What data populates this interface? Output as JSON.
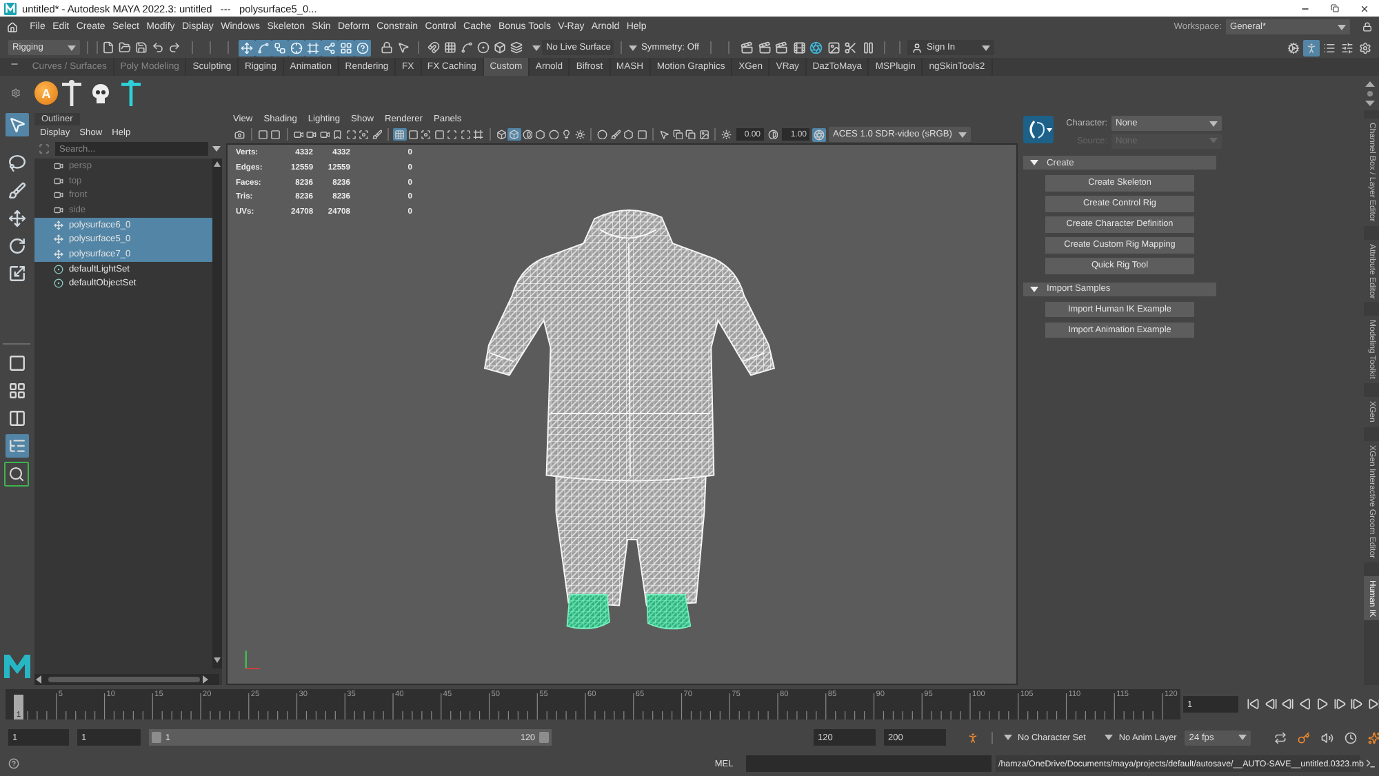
{
  "window": {
    "title": "untitled* - Autodesk MAYA 2022.3: untitled   ---   polysurface5_0..."
  },
  "menu_bar": {
    "items": [
      "File",
      "Edit",
      "Create",
      "Select",
      "Modify",
      "Display",
      "Windows",
      "Skeleton",
      "Skin",
      "Deform",
      "Constrain",
      "Control",
      "Cache",
      "Bonus Tools",
      "V-Ray",
      "Arnold",
      "Help"
    ],
    "workspace_label": "Workspace:",
    "workspace": "General*"
  },
  "status_line": {
    "menu_set": "Rigging",
    "selection_masks": [
      {
        "on": true
      },
      {
        "on": true
      },
      {
        "on": true
      },
      {
        "on": true
      },
      {
        "on": true
      },
      {
        "on": true
      },
      {
        "on": true
      },
      {
        "on": true
      }
    ],
    "live_surface": "No Live Surface",
    "symmetry": "Symmetry: Off",
    "sign_in": "Sign In",
    "panel_toggles": [
      {
        "on": false
      },
      {
        "on": true
      },
      {
        "on": false
      },
      {
        "on": false
      },
      {
        "on": false
      }
    ]
  },
  "shelf": {
    "tabs": [
      {
        "label": "Curves / Surfaces",
        "selected": false,
        "dimmed": true
      },
      {
        "label": "Poly Modeling",
        "selected": false,
        "dimmed": true
      },
      {
        "label": "Sculpting",
        "selected": false,
        "dimmed": false
      },
      {
        "label": "Rigging",
        "selected": false,
        "dimmed": false
      },
      {
        "label": "Animation",
        "selected": false,
        "dimmed": false
      },
      {
        "label": "Rendering",
        "selected": false,
        "dimmed": false
      },
      {
        "label": "FX",
        "selected": false,
        "dimmed": false
      },
      {
        "label": "FX Caching",
        "selected": false,
        "dimmed": false
      },
      {
        "label": "Custom",
        "selected": true,
        "dimmed": false
      },
      {
        "label": "Arnold",
        "selected": false,
        "dimmed": false
      },
      {
        "label": "Bifrost",
        "selected": false,
        "dimmed": false
      },
      {
        "label": "MASH",
        "selected": false,
        "dimmed": false
      },
      {
        "label": "Motion Graphics",
        "selected": false,
        "dimmed": false
      },
      {
        "label": "XGen",
        "selected": false,
        "dimmed": false
      },
      {
        "label": "VRay",
        "selected": false,
        "dimmed": false
      },
      {
        "label": "DazToMaya",
        "selected": false,
        "dimmed": false
      },
      {
        "label": "MSPlugin",
        "selected": false,
        "dimmed": false
      },
      {
        "label": "ngSkinTools2",
        "selected": false,
        "dimmed": false
      }
    ],
    "badge_button": {
      "label": "A"
    }
  },
  "toolbox": {
    "tools": [
      {
        "selected": true
      },
      {
        "selected": false
      },
      {
        "selected": false
      },
      {
        "selected": false
      },
      {
        "selected": false
      },
      {
        "selected": false
      }
    ],
    "layouts": [
      {
        "selected": false
      },
      {
        "selected": false
      },
      {
        "selected": false
      },
      {
        "selected": true
      }
    ]
  },
  "outliner": {
    "tab": "Outliner",
    "menu": [
      "Display",
      "Show",
      "Help"
    ],
    "search_placeholder": "Search...",
    "items": [
      {
        "label": "persp",
        "kind": "camera",
        "hidden": true,
        "selected": false
      },
      {
        "label": "top",
        "kind": "camera",
        "hidden": true,
        "selected": false
      },
      {
        "label": "front",
        "kind": "camera",
        "hidden": true,
        "selected": false
      },
      {
        "label": "side",
        "kind": "camera",
        "hidden": true,
        "selected": false
      },
      {
        "label": "polysurface6_0",
        "kind": "mesh",
        "hidden": false,
        "selected": true
      },
      {
        "label": "polysurface5_0",
        "kind": "mesh",
        "hidden": false,
        "selected": true
      },
      {
        "label": "polysurface7_0",
        "kind": "mesh",
        "hidden": false,
        "selected": true
      },
      {
        "label": "defaultLightSet",
        "kind": "set",
        "hidden": false,
        "selected": false
      },
      {
        "label": "defaultObjectSet",
        "kind": "set",
        "hidden": false,
        "selected": false
      }
    ]
  },
  "viewport": {
    "menu": [
      "View",
      "Shading",
      "Lighting",
      "Show",
      "Renderer",
      "Panels"
    ],
    "toggles": {
      "grid": true,
      "smooth_shade": true,
      "color_management": true
    },
    "exposure": "0.00",
    "gamma": "1.00",
    "color_space": "ACES 1.0 SDR-video (sRGB)",
    "hud": [
      {
        "label": "Verts:",
        "values": [
          "4332",
          "4332",
          "0"
        ]
      },
      {
        "label": "Edges:",
        "values": [
          "12559",
          "12559",
          "0"
        ]
      },
      {
        "label": "Faces:",
        "values": [
          "8236",
          "8236",
          "0"
        ]
      },
      {
        "label": "Tris:",
        "values": [
          "8236",
          "8236",
          "0"
        ]
      },
      {
        "label": "UVs:",
        "values": [
          "24708",
          "24708",
          "0"
        ]
      }
    ]
  },
  "human_ik": {
    "character_label": "Character:",
    "character": "None",
    "source_label": "Source:",
    "source": "None",
    "source_disabled": true,
    "sections": [
      {
        "title": "Create",
        "expanded": true,
        "buttons": [
          "Create Skeleton",
          "Create Control Rig",
          "Create Character Definition",
          "Create Custom Rig Mapping",
          "Quick Rig Tool"
        ]
      },
      {
        "title": "Import Samples",
        "expanded": true,
        "buttons": [
          "Import Human IK Example",
          "Import Animation Example"
        ]
      }
    ]
  },
  "side_tabs": [
    {
      "label": "Channel Box / Layer Editor",
      "selected": false
    },
    {
      "label": "Attribute Editor",
      "selected": false
    },
    {
      "label": "Modeling Toolkit",
      "selected": false
    },
    {
      "label": "XGen",
      "selected": false
    },
    {
      "label": "XGen Interactive Groom Editor",
      "selected": false
    },
    {
      "label": "Human IK",
      "selected": true
    }
  ],
  "timeline": {
    "marker": "1",
    "ticks": [
      "5",
      "10",
      "15",
      "20",
      "25",
      "30",
      "35",
      "40",
      "45",
      "50",
      "55",
      "60",
      "65",
      "70",
      "75",
      "80",
      "85",
      "90",
      "95",
      "100",
      "105",
      "110",
      "115",
      "120"
    ],
    "current_frame": "1"
  },
  "range_slider": {
    "start": "1",
    "playback_start": "1",
    "range_start": "1",
    "range_end": "120",
    "playback_end": "120",
    "end": "200",
    "character_set": "No Character Set",
    "anim_layer": "No Anim Layer",
    "fps": "24 fps"
  },
  "command_line": {
    "language": "MEL",
    "result": "/hamza/OneDrive/Documents/maya/projects/default/autosave/__AUTO-SAVE__untitled.0323.mb"
  }
}
